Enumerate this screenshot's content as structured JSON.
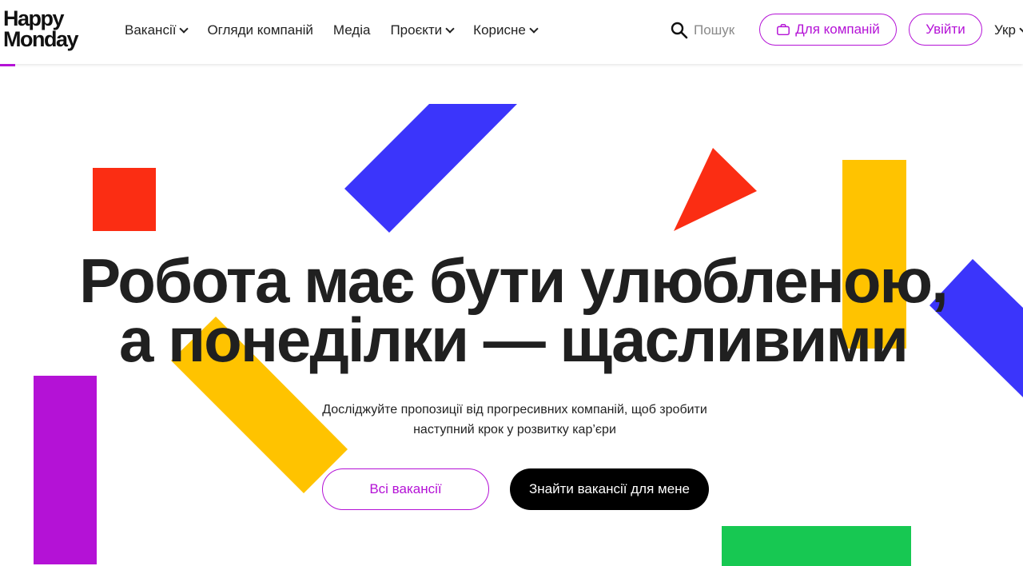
{
  "logo": {
    "line1": "Happy",
    "line2": "Monday"
  },
  "nav": {
    "vacancies": "Вакансії",
    "reviews": "Огляди компаній",
    "media": "Медіа",
    "projects": "Проєкти",
    "useful": "Корисне"
  },
  "search": {
    "placeholder": "Пошук"
  },
  "header_buttons": {
    "for_companies": "Для компаній",
    "login": "Увійти",
    "language": "Укр"
  },
  "hero": {
    "title_line1": "Робота має бути улюбленою,",
    "title_line2": "а понеділки — щасливими",
    "subtitle_line1": "Досліджуйте пропозиції від прогресивних компаній, щоб зробити",
    "subtitle_line2": "наступний крок у розвитку кар’єри",
    "cta_all": "Всі вакансії",
    "cta_find": "Знайти вакансії для мене"
  },
  "colors": {
    "accent": "#b412d6",
    "blue": "#3b35fb",
    "red": "#fb2d13",
    "yellow": "#ffc300",
    "purple": "#b412d6",
    "green": "#17c852"
  }
}
